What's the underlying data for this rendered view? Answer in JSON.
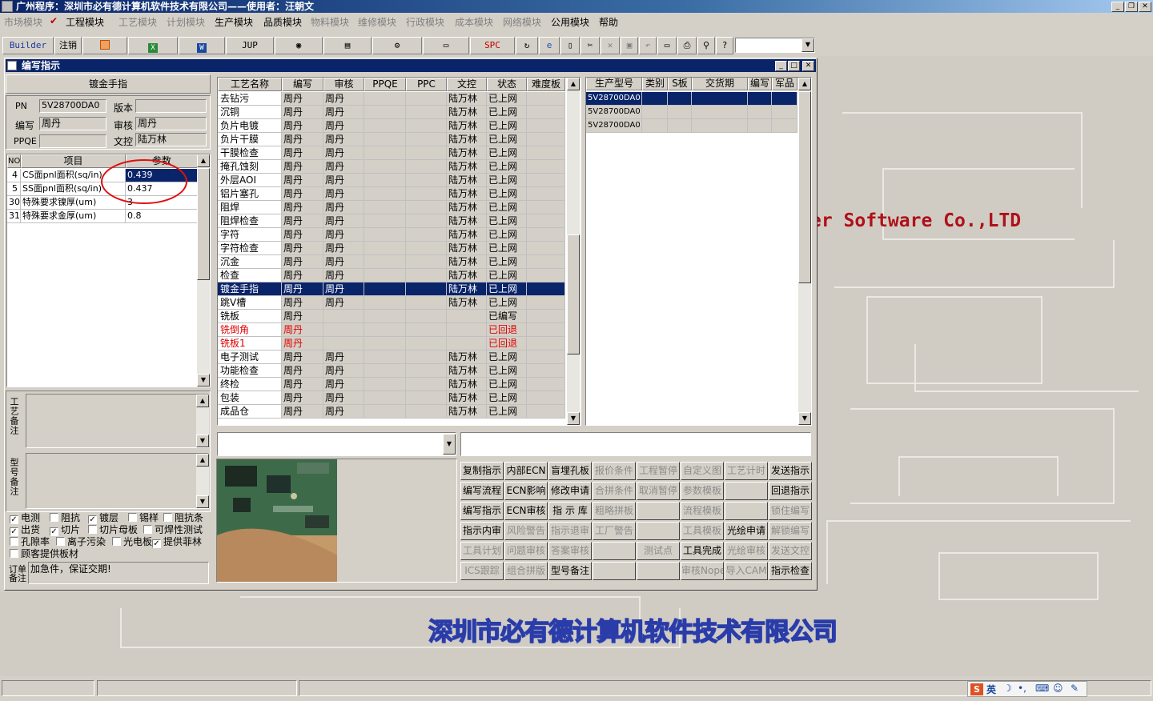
{
  "window": {
    "title": "广州程序：深圳市必有德计算机软件技术有限公司——使用者：汪朝文"
  },
  "menu": [
    {
      "label": "市场模块",
      "enabled": false
    },
    {
      "label": "工程模块",
      "enabled": true,
      "checked": true
    },
    {
      "label": "工艺模块",
      "enabled": false
    },
    {
      "label": "计划模块",
      "enabled": false
    },
    {
      "label": "生产模块",
      "enabled": true
    },
    {
      "label": "品质模块",
      "enabled": true
    },
    {
      "label": "物料模块",
      "enabled": false
    },
    {
      "label": "维修模块",
      "enabled": false
    },
    {
      "label": "行政模块",
      "enabled": false
    },
    {
      "label": "成本模块",
      "enabled": false
    },
    {
      "label": "网络模块",
      "enabled": false
    },
    {
      "label": "公用模块",
      "enabled": true
    },
    {
      "label": "帮助",
      "enabled": true
    }
  ],
  "toolbar": {
    "builder": "Builder",
    "logout": "注销",
    "jup": "JUP",
    "spc": "SPC"
  },
  "desktop": {
    "company_en": "er Software Co.,LTD",
    "company_cn": "深圳市必有德计算机软件技术有限公司"
  },
  "dialog": {
    "title": "编写指示",
    "process_name": "镀金手指",
    "pn_label": "PN",
    "pn": "5V28700DA0",
    "version_label": "版本",
    "version": "",
    "writer_label": "编写",
    "writer": "周丹",
    "reviewer_label": "审核",
    "reviewer": "周丹",
    "ppqe_label": "PPQE",
    "ppqe": "",
    "docctrl_label": "文控",
    "docctrl": "陆万林"
  },
  "params": {
    "headers": [
      "NO",
      "项目",
      "参数"
    ],
    "rows": [
      {
        "no": "4",
        "item": "CS面pnl面积(sq/in)",
        "value": "0.439",
        "selected": true
      },
      {
        "no": "5",
        "item": "SS面pnl面积(sq/in)",
        "value": "0.437"
      },
      {
        "no": "30",
        "item": "特殊要求镍厚(um)",
        "value": "3"
      },
      {
        "no": "31",
        "item": "特殊要求金厚(um)",
        "value": "0.8"
      }
    ]
  },
  "remarks": {
    "process_label": "工艺备注",
    "model_label": "型号备注",
    "order_label": "订单备注",
    "order_text": "加急件，保证交期!"
  },
  "options": [
    {
      "label": "电测",
      "checked": true
    },
    {
      "label": "阻抗",
      "checked": false
    },
    {
      "label": "镀层",
      "checked": true
    },
    {
      "label": "锡样",
      "checked": false
    },
    {
      "label": "阻抗条",
      "checked": false
    },
    {
      "label": "出货",
      "checked": true
    },
    {
      "label": "切片",
      "checked": true
    },
    {
      "label": "切片母板",
      "checked": false
    },
    {
      "label": "可焊性测试",
      "checked": false
    },
    {
      "label": "孔隙率",
      "checked": false
    },
    {
      "label": "离子污染",
      "checked": false
    },
    {
      "label": "光电板",
      "checked": false
    },
    {
      "label": "提供菲林",
      "checked": true
    },
    {
      "label": "顾客提供板材",
      "checked": false
    }
  ],
  "processes": {
    "headers": [
      "工艺名称",
      "编写",
      "审核",
      "PPQE",
      "PPC",
      "文控",
      "状态",
      "难度板"
    ],
    "rows": [
      {
        "name": "去钻污",
        "writer": "周丹",
        "reviewer": "周丹",
        "docctrl": "陆万林",
        "status": "已上网"
      },
      {
        "name": "沉铜",
        "writer": "周丹",
        "reviewer": "周丹",
        "docctrl": "陆万林",
        "status": "已上网"
      },
      {
        "name": "负片电镀",
        "writer": "周丹",
        "reviewer": "周丹",
        "docctrl": "陆万林",
        "status": "已上网"
      },
      {
        "name": "负片干膜",
        "writer": "周丹",
        "reviewer": "周丹",
        "docctrl": "陆万林",
        "status": "已上网"
      },
      {
        "name": "干膜检查",
        "writer": "周丹",
        "reviewer": "周丹",
        "docctrl": "陆万林",
        "status": "已上网"
      },
      {
        "name": "掩孔蚀刻",
        "writer": "周丹",
        "reviewer": "周丹",
        "docctrl": "陆万林",
        "status": "已上网"
      },
      {
        "name": "外层AOI",
        "writer": "周丹",
        "reviewer": "周丹",
        "docctrl": "陆万林",
        "status": "已上网"
      },
      {
        "name": "铝片塞孔",
        "writer": "周丹",
        "reviewer": "周丹",
        "docctrl": "陆万林",
        "status": "已上网"
      },
      {
        "name": "阻焊",
        "writer": "周丹",
        "reviewer": "周丹",
        "docctrl": "陆万林",
        "status": "已上网"
      },
      {
        "name": "阻焊检查",
        "writer": "周丹",
        "reviewer": "周丹",
        "docctrl": "陆万林",
        "status": "已上网"
      },
      {
        "name": "字符",
        "writer": "周丹",
        "reviewer": "周丹",
        "docctrl": "陆万林",
        "status": "已上网"
      },
      {
        "name": "字符检查",
        "writer": "周丹",
        "reviewer": "周丹",
        "docctrl": "陆万林",
        "status": "已上网"
      },
      {
        "name": "沉金",
        "writer": "周丹",
        "reviewer": "周丹",
        "docctrl": "陆万林",
        "status": "已上网"
      },
      {
        "name": "检查",
        "writer": "周丹",
        "reviewer": "周丹",
        "docctrl": "陆万林",
        "status": "已上网"
      },
      {
        "name": "镀金手指",
        "writer": "周丹",
        "reviewer": "周丹",
        "docctrl": "陆万林",
        "status": "已上网",
        "selected": true
      },
      {
        "name": "跳V槽",
        "writer": "周丹",
        "reviewer": "周丹",
        "docctrl": "陆万林",
        "status": "已上网"
      },
      {
        "name": "铣板",
        "writer": "周丹",
        "reviewer": "",
        "docctrl": "",
        "status": "已编写"
      },
      {
        "name": "铣倒角",
        "writer": "周丹",
        "reviewer": "",
        "docctrl": "",
        "status": "已回退",
        "red": true
      },
      {
        "name": "铣板1",
        "writer": "周丹",
        "reviewer": "",
        "docctrl": "",
        "status": "已回退",
        "red": true
      },
      {
        "name": "电子测试",
        "writer": "周丹",
        "reviewer": "周丹",
        "docctrl": "陆万林",
        "status": "已上网"
      },
      {
        "name": "功能检查",
        "writer": "周丹",
        "reviewer": "周丹",
        "docctrl": "陆万林",
        "status": "已上网"
      },
      {
        "name": "终检",
        "writer": "周丹",
        "reviewer": "周丹",
        "docctrl": "陆万林",
        "status": "已上网"
      },
      {
        "name": "包装",
        "writer": "周丹",
        "reviewer": "周丹",
        "docctrl": "陆万林",
        "status": "已上网"
      },
      {
        "name": "成品仓",
        "writer": "周丹",
        "reviewer": "周丹",
        "docctrl": "陆万林",
        "status": "已上网"
      }
    ]
  },
  "models": {
    "headers": [
      "生产型号",
      "类别",
      "S板",
      "交货期",
      "编写",
      "军品"
    ],
    "rows": [
      {
        "model": "5V28700DA0",
        "selected": true
      },
      {
        "model": "5V28700DA0"
      },
      {
        "model": "5V28700DA0"
      }
    ]
  },
  "actions": [
    {
      "label": "复制指示",
      "enabled": true
    },
    {
      "label": "内部ECN",
      "enabled": true
    },
    {
      "label": "盲埋孔板",
      "enabled": true
    },
    {
      "label": "报价条件",
      "enabled": false
    },
    {
      "label": "工程暂停",
      "enabled": false
    },
    {
      "label": "自定义图",
      "enabled": false
    },
    {
      "label": "工艺计时",
      "enabled": false
    },
    {
      "label": "发送指示",
      "enabled": true
    },
    {
      "label": "编写流程",
      "enabled": true
    },
    {
      "label": "ECN影响",
      "enabled": true
    },
    {
      "label": "修改申请",
      "enabled": true
    },
    {
      "label": "合拼条件",
      "enabled": false
    },
    {
      "label": "取消暂停",
      "enabled": false
    },
    {
      "label": "参数模板",
      "enabled": false
    },
    {
      "label": "",
      "enabled": false
    },
    {
      "label": "回退指示",
      "enabled": true
    },
    {
      "label": "编写指示",
      "enabled": true
    },
    {
      "label": "ECN审核",
      "enabled": true
    },
    {
      "label": "指 示 库",
      "enabled": true
    },
    {
      "label": "粗略拼板",
      "enabled": false
    },
    {
      "label": "",
      "enabled": false
    },
    {
      "label": "流程模板",
      "enabled": false
    },
    {
      "label": "",
      "enabled": false
    },
    {
      "label": "锁住编写",
      "enabled": false
    },
    {
      "label": "指示内审",
      "enabled": true
    },
    {
      "label": "风险警告",
      "enabled": false
    },
    {
      "label": "指示退审",
      "enabled": false
    },
    {
      "label": "工厂警告",
      "enabled": false
    },
    {
      "label": "",
      "enabled": false
    },
    {
      "label": "工具模板",
      "enabled": false
    },
    {
      "label": "光绘申请",
      "enabled": true
    },
    {
      "label": "解锁编写",
      "enabled": false
    },
    {
      "label": "工具计划",
      "enabled": false
    },
    {
      "label": "问题审核",
      "enabled": false
    },
    {
      "label": "答案审核",
      "enabled": false
    },
    {
      "label": "",
      "enabled": false
    },
    {
      "label": "测试点",
      "enabled": false
    },
    {
      "label": "工具完成",
      "enabled": true
    },
    {
      "label": "光绘审核",
      "enabled": false
    },
    {
      "label": "发送文控",
      "enabled": false
    },
    {
      "label": "ICS跟踪",
      "enabled": false
    },
    {
      "label": "组合拼版",
      "enabled": false
    },
    {
      "label": "型号备注",
      "enabled": true
    },
    {
      "label": "",
      "enabled": false
    },
    {
      "label": "",
      "enabled": false
    },
    {
      "label": "审核Nope",
      "enabled": false
    },
    {
      "label": "导入CAM",
      "enabled": false
    },
    {
      "label": "指示检查",
      "enabled": true
    }
  ],
  "ime": {
    "lang": "英"
  }
}
